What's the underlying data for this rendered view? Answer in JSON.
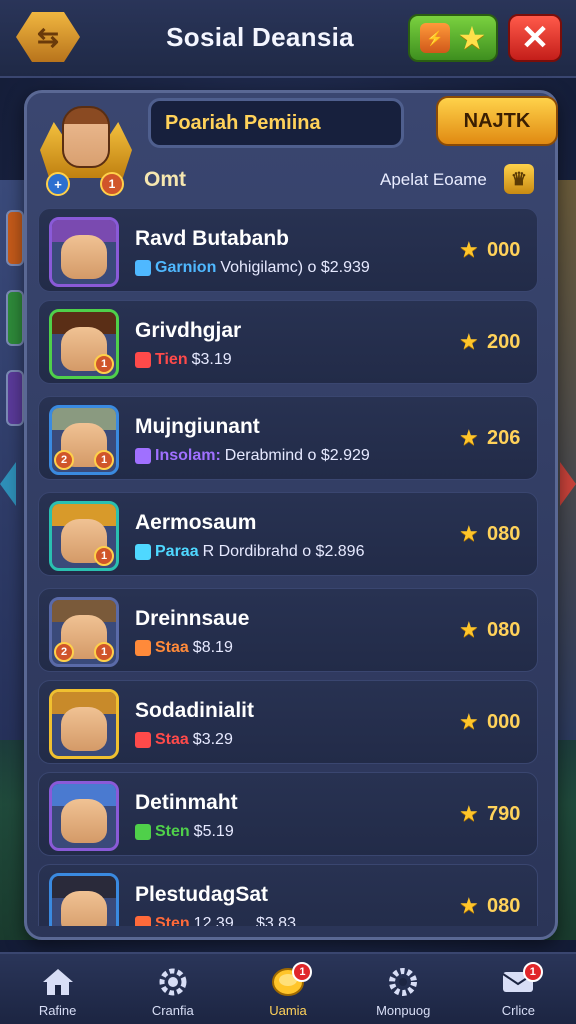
{
  "header": {
    "title": "Sosial Deansia",
    "logo_icon": "shield-logo-icon",
    "close_symbol": "✕",
    "green_button_card": "⚡"
  },
  "panel": {
    "search_text": "Poariah Pemiina",
    "gold_button_label": "NAJTK",
    "sub_left": "Omt",
    "sub_right": "Apelat Eoame",
    "player_level_left": "+",
    "player_level_right": "1"
  },
  "rows": [
    {
      "name": "Ravd Butabanb",
      "tag": "Garnion",
      "tag_color": "#4fb8ff",
      "detail": "Vohigilamc) o $2.939",
      "score": "000",
      "frame": "#8a5ad8",
      "hair": "#7a4ab0",
      "badge_l": "",
      "badge_r": ""
    },
    {
      "name": "Grivdhgjar",
      "tag": "Tien",
      "tag_color": "#ff4a4a",
      "detail": "$3.19",
      "score": "200",
      "frame": "#4fd04a",
      "hair": "#5a2e16",
      "badge_l": "",
      "badge_r": "1"
    },
    {
      "name": "Mujngiunant",
      "tag": "Insolam:",
      "tag_color": "#a070ff",
      "detail": "Derabmind o $2.929",
      "score": "206",
      "frame": "#3a8ae0",
      "hair": "#8a9a80",
      "badge_l": "2",
      "badge_r": "1"
    },
    {
      "name": "Aermosaum",
      "tag": "Paraa",
      "tag_color": "#4fd8ff",
      "detail": "R Dordibrahd o $2.896",
      "score": "080",
      "frame": "#2ac0b0",
      "hair": "#d89a2a",
      "badge_l": "",
      "badge_r": "1"
    },
    {
      "name": "Dreinnsaue",
      "tag": "Staa",
      "tag_color": "#ff8a3a",
      "detail": "$8.19",
      "score": "080",
      "frame": "#5a6aa8",
      "hair": "#7a5a3a",
      "badge_l": "2",
      "badge_r": "1"
    },
    {
      "name": "Sodadinialit",
      "tag": "Staa",
      "tag_color": "#ff4a4a",
      "detail": "$3.29",
      "score": "000",
      "frame": "#f0c030",
      "hair": "#c88a2a",
      "badge_l": "",
      "badge_r": ""
    },
    {
      "name": "Detinmaht",
      "tag": "Sten",
      "tag_color": "#4fd04a",
      "detail": "$5.19",
      "score": "790",
      "frame": "#8a5ad8",
      "hair": "#4a7ad0",
      "badge_l": "",
      "badge_r": ""
    },
    {
      "name": "PlestudagSat",
      "tag": "Sten",
      "tag_color": "#ff6a3a",
      "detail": "12.39 ... $3.83",
      "score": "080",
      "frame": "#3a8ae0",
      "hair": "#2a2a3a",
      "badge_l": "",
      "badge_r": ""
    }
  ],
  "nav": [
    {
      "label": "Rafine",
      "icon": "home-icon",
      "badge": "",
      "active": false
    },
    {
      "label": "Cranfia",
      "icon": "gear-icon",
      "badge": "",
      "active": false
    },
    {
      "label": "Uamia",
      "icon": "gold-coin-icon",
      "badge": "1",
      "active": true
    },
    {
      "label": "Monpuog",
      "icon": "cog-icon",
      "badge": "",
      "active": false
    },
    {
      "label": "Crlice",
      "icon": "mail-icon",
      "badge": "1",
      "active": false
    }
  ],
  "colors": {
    "accent_gold": "#ffd25a",
    "panel_bg": "#2b3558",
    "header_bg": "#1f2946"
  }
}
